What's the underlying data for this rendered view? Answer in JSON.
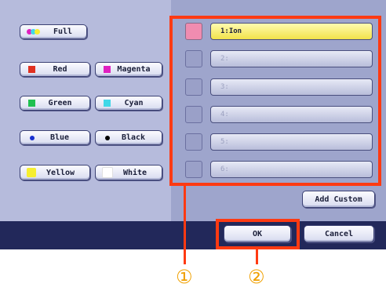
{
  "colors": {
    "accent_highlight": "#ff3a12",
    "callout": "#f0a000",
    "selected_slot": "#f5e64c",
    "selected_swatch": "#f08cb0"
  },
  "left": {
    "full_label": "Full",
    "buttons": [
      {
        "label": "Red",
        "swatch": "#e03020"
      },
      {
        "label": "Magenta",
        "swatch": "#e020c0"
      },
      {
        "label": "Green",
        "swatch": "#20c050"
      },
      {
        "label": "Cyan",
        "swatch": "#40d8e8"
      },
      {
        "label": "Blue",
        "swatch": "#1830d0"
      },
      {
        "label": "Black",
        "swatch": "#000000"
      },
      {
        "label": "Yellow",
        "swatch": "#f6ee30"
      },
      {
        "label": "White",
        "swatch": "#ffffff"
      }
    ]
  },
  "slots": [
    {
      "label": "1:Ion"
    },
    {
      "label": "2:"
    },
    {
      "label": "3:"
    },
    {
      "label": "4:"
    },
    {
      "label": "5:"
    },
    {
      "label": "6:"
    }
  ],
  "add_custom_label": "Add Custom",
  "ok_label": "OK",
  "cancel_label": "Cancel",
  "callouts": {
    "one": "①",
    "two": "②"
  }
}
